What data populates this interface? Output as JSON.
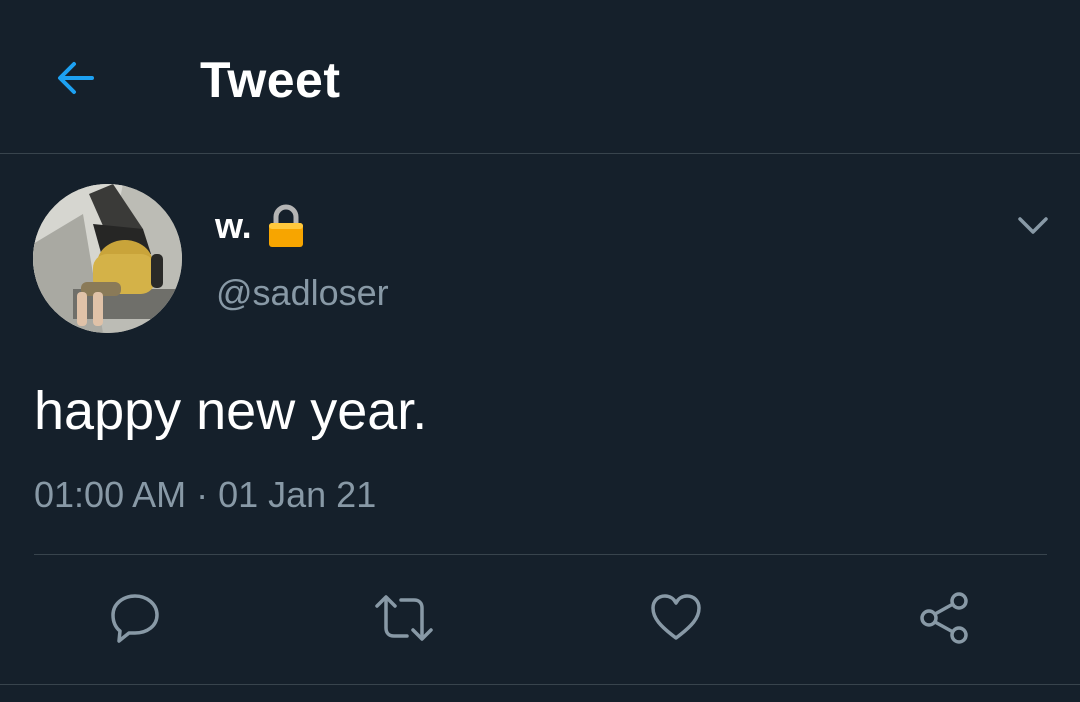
{
  "header": {
    "title": "Tweet",
    "back_icon": "arrow-left-icon",
    "accent_color": "#1da1f2"
  },
  "tweet": {
    "display_name": "w.",
    "username": "@sadloser",
    "text": "happy new year.",
    "timestamp": "01:00 AM · 01 Jan 21",
    "protected_icon": "lock-icon",
    "more_icon": "chevron-down-icon"
  },
  "actions": [
    {
      "name": "reply",
      "icon": "reply-icon"
    },
    {
      "name": "retweet",
      "icon": "retweet-icon"
    },
    {
      "name": "like",
      "icon": "heart-icon"
    },
    {
      "name": "share",
      "icon": "share-icon"
    }
  ],
  "colors": {
    "background": "#15202b",
    "secondary_text": "#8899a6",
    "divider": "#38444d"
  }
}
